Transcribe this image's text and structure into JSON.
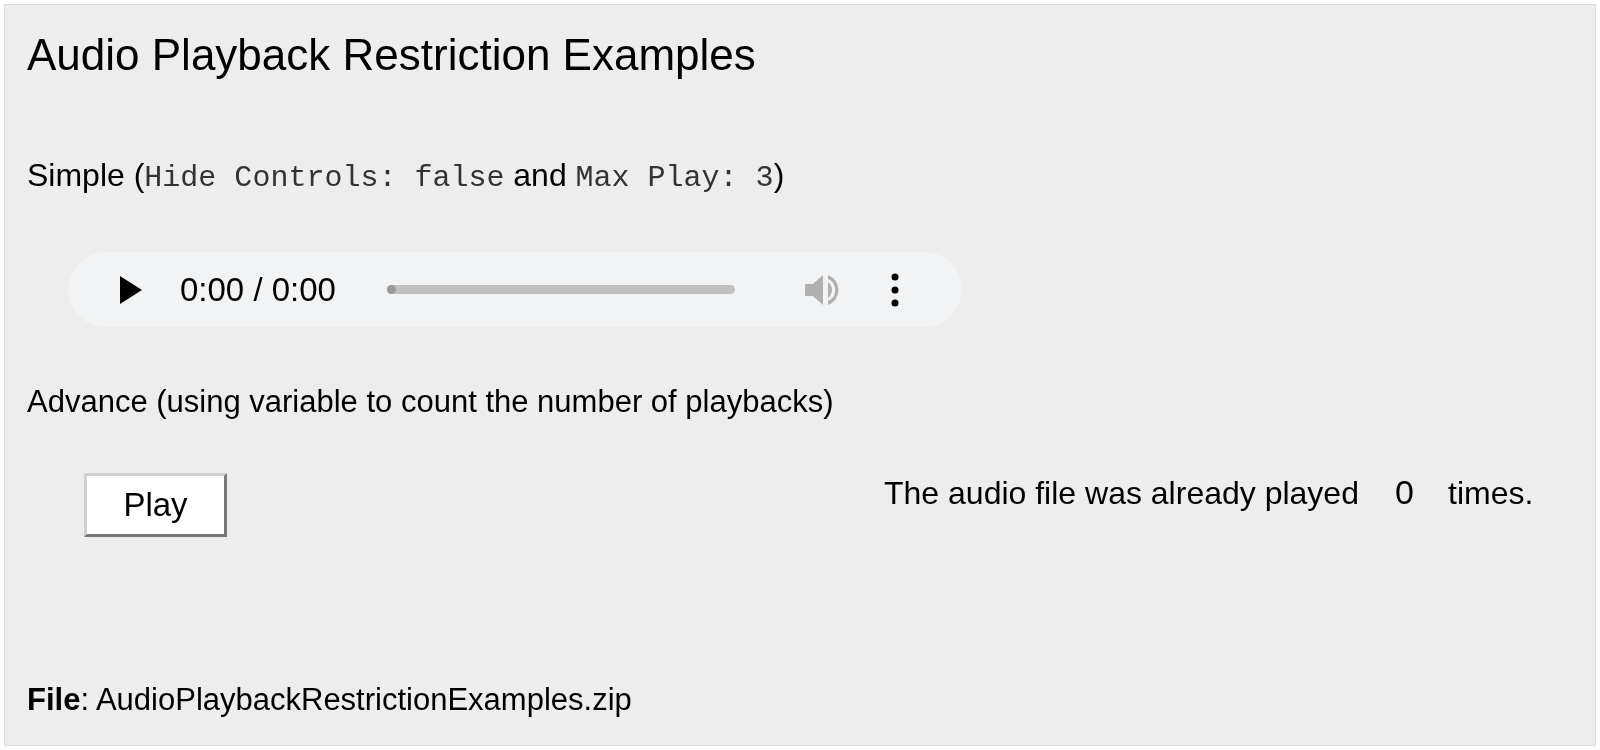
{
  "title": "Audio Playback Restriction Examples",
  "simple": {
    "parts": [
      {
        "kind": "text",
        "text": "Simple ("
      },
      {
        "kind": "code",
        "text": "Hide Controls: false"
      },
      {
        "kind": "text",
        "text": " and "
      },
      {
        "kind": "code",
        "text": "Max Play: 3"
      },
      {
        "kind": "text",
        "text": ")"
      }
    ]
  },
  "audio_player": {
    "time": "0:00 / 0:00",
    "level": 0
  },
  "advance": {
    "label": "Advance (using variable to count the number of playbacks)",
    "button": "Play",
    "status_prefix": "The audio file was already played",
    "count": "0",
    "status_suffix": "times."
  },
  "file": {
    "label": "File",
    "name": ": AudioPlaybackRestrictionExamples.zip"
  }
}
